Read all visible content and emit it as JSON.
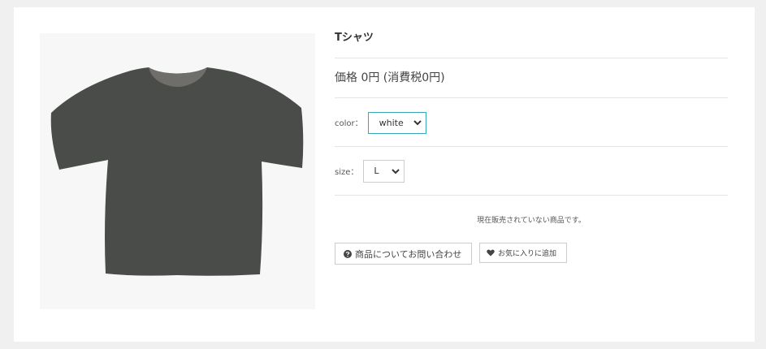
{
  "product": {
    "title": "Tシャツ",
    "price_text": "価格 0円 (消費税0円)",
    "image_alt": "t-shirt-image"
  },
  "options": {
    "color": {
      "label": "color：",
      "selected": "white"
    },
    "size": {
      "label": "size：",
      "selected": "L"
    }
  },
  "notice": "現在販売されていない商品です。",
  "actions": {
    "inquiry_label": "商品についてお問い合わせ",
    "favorite_label": "お気に入りに追加"
  },
  "colors": {
    "accent_border": "#35a9b8",
    "shirt": "#4a4c4a"
  },
  "icons": {
    "inquiry": "question-circle-icon",
    "favorite": "heart-icon",
    "select": "chevron-down-icon"
  }
}
